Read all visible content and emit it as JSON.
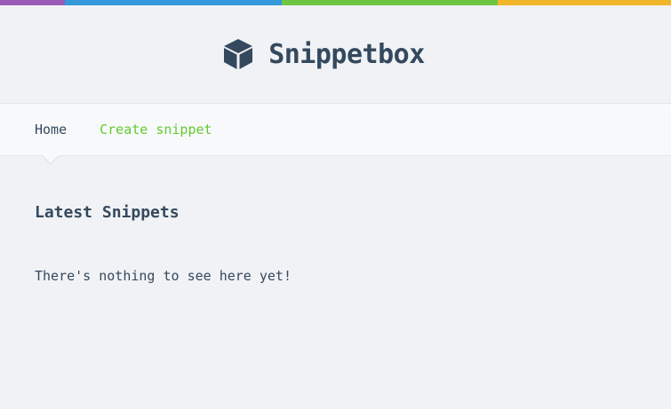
{
  "header": {
    "brand_name": "Snippetbox",
    "logo_icon": "cube-icon"
  },
  "colors": {
    "bar_purple": "#9b59b6",
    "bar_blue": "#3498db",
    "bar_green": "#6cc644",
    "bar_yellow": "#f1b52a",
    "text": "#34495e",
    "link_accent": "#62cb31"
  },
  "nav": {
    "home_label": "Home",
    "create_label": "Create snippet",
    "active": "Home"
  },
  "main": {
    "heading": "Latest Snippets",
    "empty_message": "There's nothing to see here yet!"
  }
}
